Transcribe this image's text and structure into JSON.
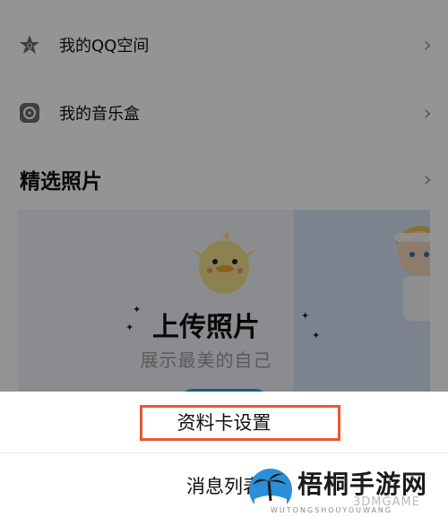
{
  "profile_rows": [
    {
      "label": "我的QQ空间",
      "icon": "star-icon"
    },
    {
      "label": "我的音乐盒",
      "icon": "music-disc-icon"
    }
  ],
  "photos_section": {
    "title": "精选照片",
    "upload_title": "上传照片",
    "upload_subtitle": "展示最美的自己"
  },
  "action_sheet": {
    "items": [
      "资料卡设置",
      "消息列表"
    ]
  },
  "watermark": {
    "title": "梧桐手游网",
    "subtitle": "WUTONGSHOUYOUWANG",
    "overlay": "3DMGAME"
  },
  "colors": {
    "highlight_border": "#e8582d",
    "upload_button": "#2e9de8"
  }
}
